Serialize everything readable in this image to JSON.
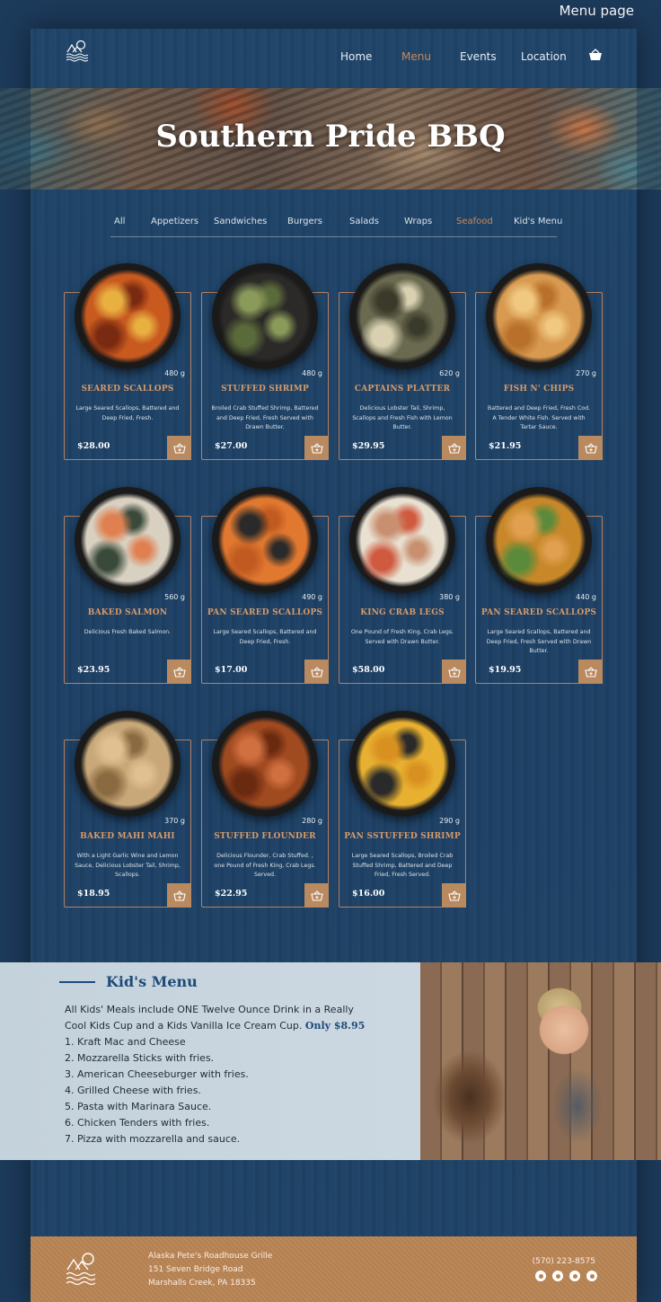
{
  "page_label": "Menu page",
  "nav": {
    "links": [
      {
        "label": "Home",
        "active": false
      },
      {
        "label": "Menu",
        "active": true
      },
      {
        "label": "Events",
        "active": false
      },
      {
        "label": "Location",
        "active": false
      }
    ]
  },
  "hero": {
    "title": "Southern Pride BBQ"
  },
  "categories": [
    {
      "label": "All",
      "active": false
    },
    {
      "label": "Appetizers",
      "active": false
    },
    {
      "label": "Sandwiches",
      "active": false
    },
    {
      "label": "Burgers",
      "active": false
    },
    {
      "label": "Salads",
      "active": false
    },
    {
      "label": "Wraps",
      "active": false
    },
    {
      "label": "Seafood",
      "active": true
    },
    {
      "label": "Kid's Menu",
      "active": false
    }
  ],
  "dishes": [
    {
      "name": "SEARED SCALLOPS",
      "weight": "480 g",
      "desc": "Large Seared Scallops, Battered and Deep Fried, Fresh.",
      "price": "$28.00",
      "colors": [
        "#c85a20",
        "#7a2a10",
        "#e8b040"
      ]
    },
    {
      "name": "STUFFED SHRIMP",
      "weight": "480 g",
      "desc": "Broiled Crab Stuffed Shrimp, Battered and Deep Fried, Fresh Served with Drawn Butter.",
      "price": "$27.00",
      "colors": [
        "#2c2a28",
        "#5a6a3a",
        "#8a9a5a"
      ]
    },
    {
      "name": "CAPTAINS PLATTER",
      "weight": "620 g",
      "desc": "Delicious Lobster Tail, Shrimp, Scallops and Fresh Fish with Lemon Butter.",
      "price": "$29.95",
      "colors": [
        "#6a6a50",
        "#d8d0b0",
        "#3a3a2a"
      ]
    },
    {
      "name": "FISH N' CHIPS",
      "weight": "270 g",
      "desc": "Battered and Deep Fried, Fresh Cod. A Tender White Fish. Served with Tartar Sauce.",
      "price": "$21.95",
      "colors": [
        "#d89a50",
        "#b8702a",
        "#f0c880"
      ]
    },
    {
      "name": "BAKED SALMON",
      "weight": "560 g",
      "desc": "Delicious Fresh Baked Salmon.",
      "price": "$23.95",
      "colors": [
        "#d8d0c0",
        "#3a4a3a",
        "#e08050"
      ]
    },
    {
      "name": "PAN SEARED SCALLOPS",
      "weight": "490 g",
      "desc": "Large Seared Scallops, Battered and Deep Fried, Fresh.",
      "price": "$17.00",
      "colors": [
        "#e07830",
        "#c05a20",
        "#2a2a2a"
      ]
    },
    {
      "name": "KING CRAB LEGS",
      "weight": "380 g",
      "desc": "One Pound of Fresh King, Crab Legs. Served with Drawn Butter.",
      "price": "$58.00",
      "colors": [
        "#e8e0d0",
        "#d05a40",
        "#c89070"
      ]
    },
    {
      "name": "PAN SEARED SCALLOPS",
      "weight": "440 g",
      "desc": "Large Seared Scallops, Battered and Deep Fried, Fresh Served with Drawn Butter.",
      "price": "$19.95",
      "colors": [
        "#c8882a",
        "#5a8a3a",
        "#e0a050"
      ]
    },
    {
      "name": "BAKED MAHI MAHI",
      "weight": "370 g",
      "desc": "With a Light Garlic Wine and Lemon Sauce, Delicious Lobster Tail, Shrimp, Scallops.",
      "price": "$18.95",
      "colors": [
        "#c8a878",
        "#8a6a40",
        "#e0c090"
      ]
    },
    {
      "name": "STUFFED FLOUNDER",
      "weight": "280 g",
      "desc": "Delicious Flounder, Crab Stuffed. , one Pound of Fresh King, Crab Legs. Served.",
      "price": "$22.95",
      "colors": [
        "#a04a20",
        "#6a2a10",
        "#d07040"
      ]
    },
    {
      "name": "PAN SSTUFFED SHRIMP",
      "weight": "290 g",
      "desc": "Large Seared Scallops, Broiled Crab Stuffed Shrimp, Battered and Deep Fried, Fresh Served.",
      "price": "$16.00",
      "colors": [
        "#e8b030",
        "#2a2a2a",
        "#d89020"
      ]
    }
  ],
  "kids": {
    "title": "Kid's Menu",
    "intro": "All Kids' Meals include ONE Twelve Ounce Drink in a Really Cool Kids Cup and a Kids Vanilla Ice Cream Cup.",
    "price": "Only $8.95",
    "items": [
      "1. Kraft Mac and Cheese",
      "2. Mozzarella Sticks with fries.",
      "3. American Cheeseburger with fries.",
      "4. Grilled Cheese with fries.",
      "5. Pasta with Marinara Sauce.",
      "6. Chicken Tenders with fries.",
      "7. Pizza with mozzarella and sauce."
    ]
  },
  "footer": {
    "address_lines": [
      "Alaska Pete's Roadhouse Grille",
      "151 Seven Bridge Road",
      "Marshalls Creek, PA 18335"
    ],
    "phone": "(570) 223-8575",
    "socials": [
      "instagram-icon",
      "facebook-icon",
      "telegram-icon",
      "twitter-icon"
    ]
  },
  "colors": {
    "accent": "#c8895a",
    "background": "#1f4468",
    "kids_title": "#1f4a78",
    "footer": "#b98455"
  }
}
